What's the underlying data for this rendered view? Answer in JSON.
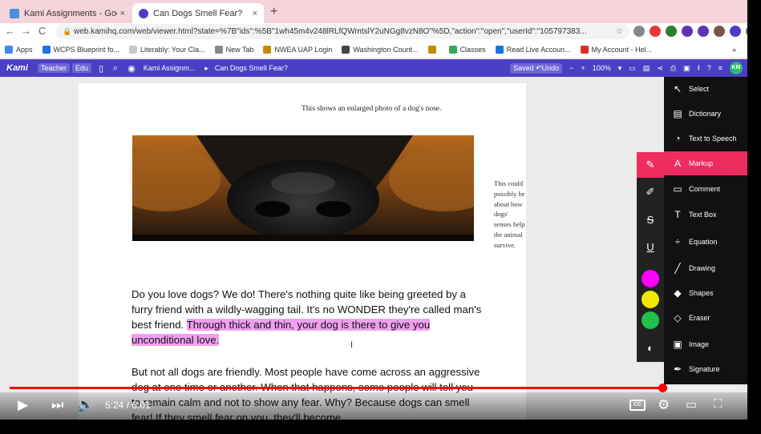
{
  "browser": {
    "tabs": [
      {
        "title": "Kami Assignments - Google D",
        "favicon_color": "#4a90d9"
      },
      {
        "title": "Can Dogs Smell Fear?",
        "favicon_color": "#4a3fc4"
      }
    ],
    "new_tab": "+",
    "close_glyph": "×",
    "url": "web.kamihq.com/web/viewer.html?state=%7B\"ids\":%5B\"1wh45m4v248lRLfQWmtslY2uNGg8vzN8O\"%5D,\"action\":\"open\",\"userId\":\"105797383...",
    "nav": {
      "back": "←",
      "forward": "→",
      "reload": "C"
    },
    "bookmarks": [
      {
        "label": "Apps",
        "color": "#4285f4"
      },
      {
        "label": "WCPS Blueprint fo...",
        "color": "#1a73e8"
      },
      {
        "label": "Literably: Your Cla...",
        "color": "#c8c8c8"
      },
      {
        "label": "New Tab",
        "color": "#888888"
      },
      {
        "label": "NWEA UAP Login",
        "color": "#c58b00"
      },
      {
        "label": "Washington Count...",
        "color": "#444444"
      },
      {
        "label": "",
        "color": "#c58b00"
      },
      {
        "label": "Classes",
        "color": "#34a853"
      },
      {
        "label": "Read Live Accoun...",
        "color": "#1a73e8"
      },
      {
        "label": "My Account - Hel...",
        "color": "#d93025"
      }
    ],
    "more_glyph": "»"
  },
  "kami": {
    "logo": "Kami",
    "badges": [
      "Teacher",
      "Edu"
    ],
    "breadcrumb": [
      "Kami Assignm...",
      "Can Dogs Smell Fear?"
    ],
    "saved_label": "Saved",
    "undo_label": "Undo",
    "zoom": "100%",
    "avatar": "KM",
    "colors": {
      "bar": "#4a3fc4",
      "accent": "#ee2c5f",
      "avatar": "#2eb872"
    }
  },
  "document": {
    "caption": "This shows an enlarged photo of a dog's nose.",
    "sidenote": "This could possibly be about how dogs' senses help the animal survive.",
    "para1_plain": "Do you love dogs? We do! There's nothing quite like being greeted by a furry friend with a wildly-wagging tail. It's no WONDER they're called man's best friend. ",
    "para1_highlight": "Through thick and thin, your dog is there to give you unconditional love.",
    "para2": "But not all dogs are friendly. Most people have come across an aggressive dog at one time or another. When that happens, some people will tell you to remain calm and not to show any fear. Why? Because dogs can smell fear! If they smell fear on you, they'll become",
    "highlight_color": "#f0a0f0"
  },
  "tools": [
    {
      "label": "Select",
      "icon": "cursor-icon"
    },
    {
      "label": "Dictionary",
      "icon": "book-icon"
    },
    {
      "label": "Text to Speech",
      "icon": "speaker-icon"
    },
    {
      "label": "Markup",
      "icon": "highlighter-icon",
      "active": true
    },
    {
      "label": "Comment",
      "icon": "comment-icon"
    },
    {
      "label": "Text Box",
      "icon": "textbox-icon"
    },
    {
      "label": "Equation",
      "icon": "divide-icon"
    },
    {
      "label": "Drawing",
      "icon": "brush-icon"
    },
    {
      "label": "Shapes",
      "icon": "shapes-icon"
    },
    {
      "label": "Eraser",
      "icon": "eraser-icon"
    },
    {
      "label": "Image",
      "icon": "image-icon"
    },
    {
      "label": "Signature",
      "icon": "signature-icon"
    }
  ],
  "markup_panel": {
    "swatches": [
      "#ff00ff",
      "#f2e600",
      "#1fc24a"
    ]
  },
  "video": {
    "time": "5:24 / 6:01",
    "progress": 0.897,
    "cc_label": "CC"
  }
}
